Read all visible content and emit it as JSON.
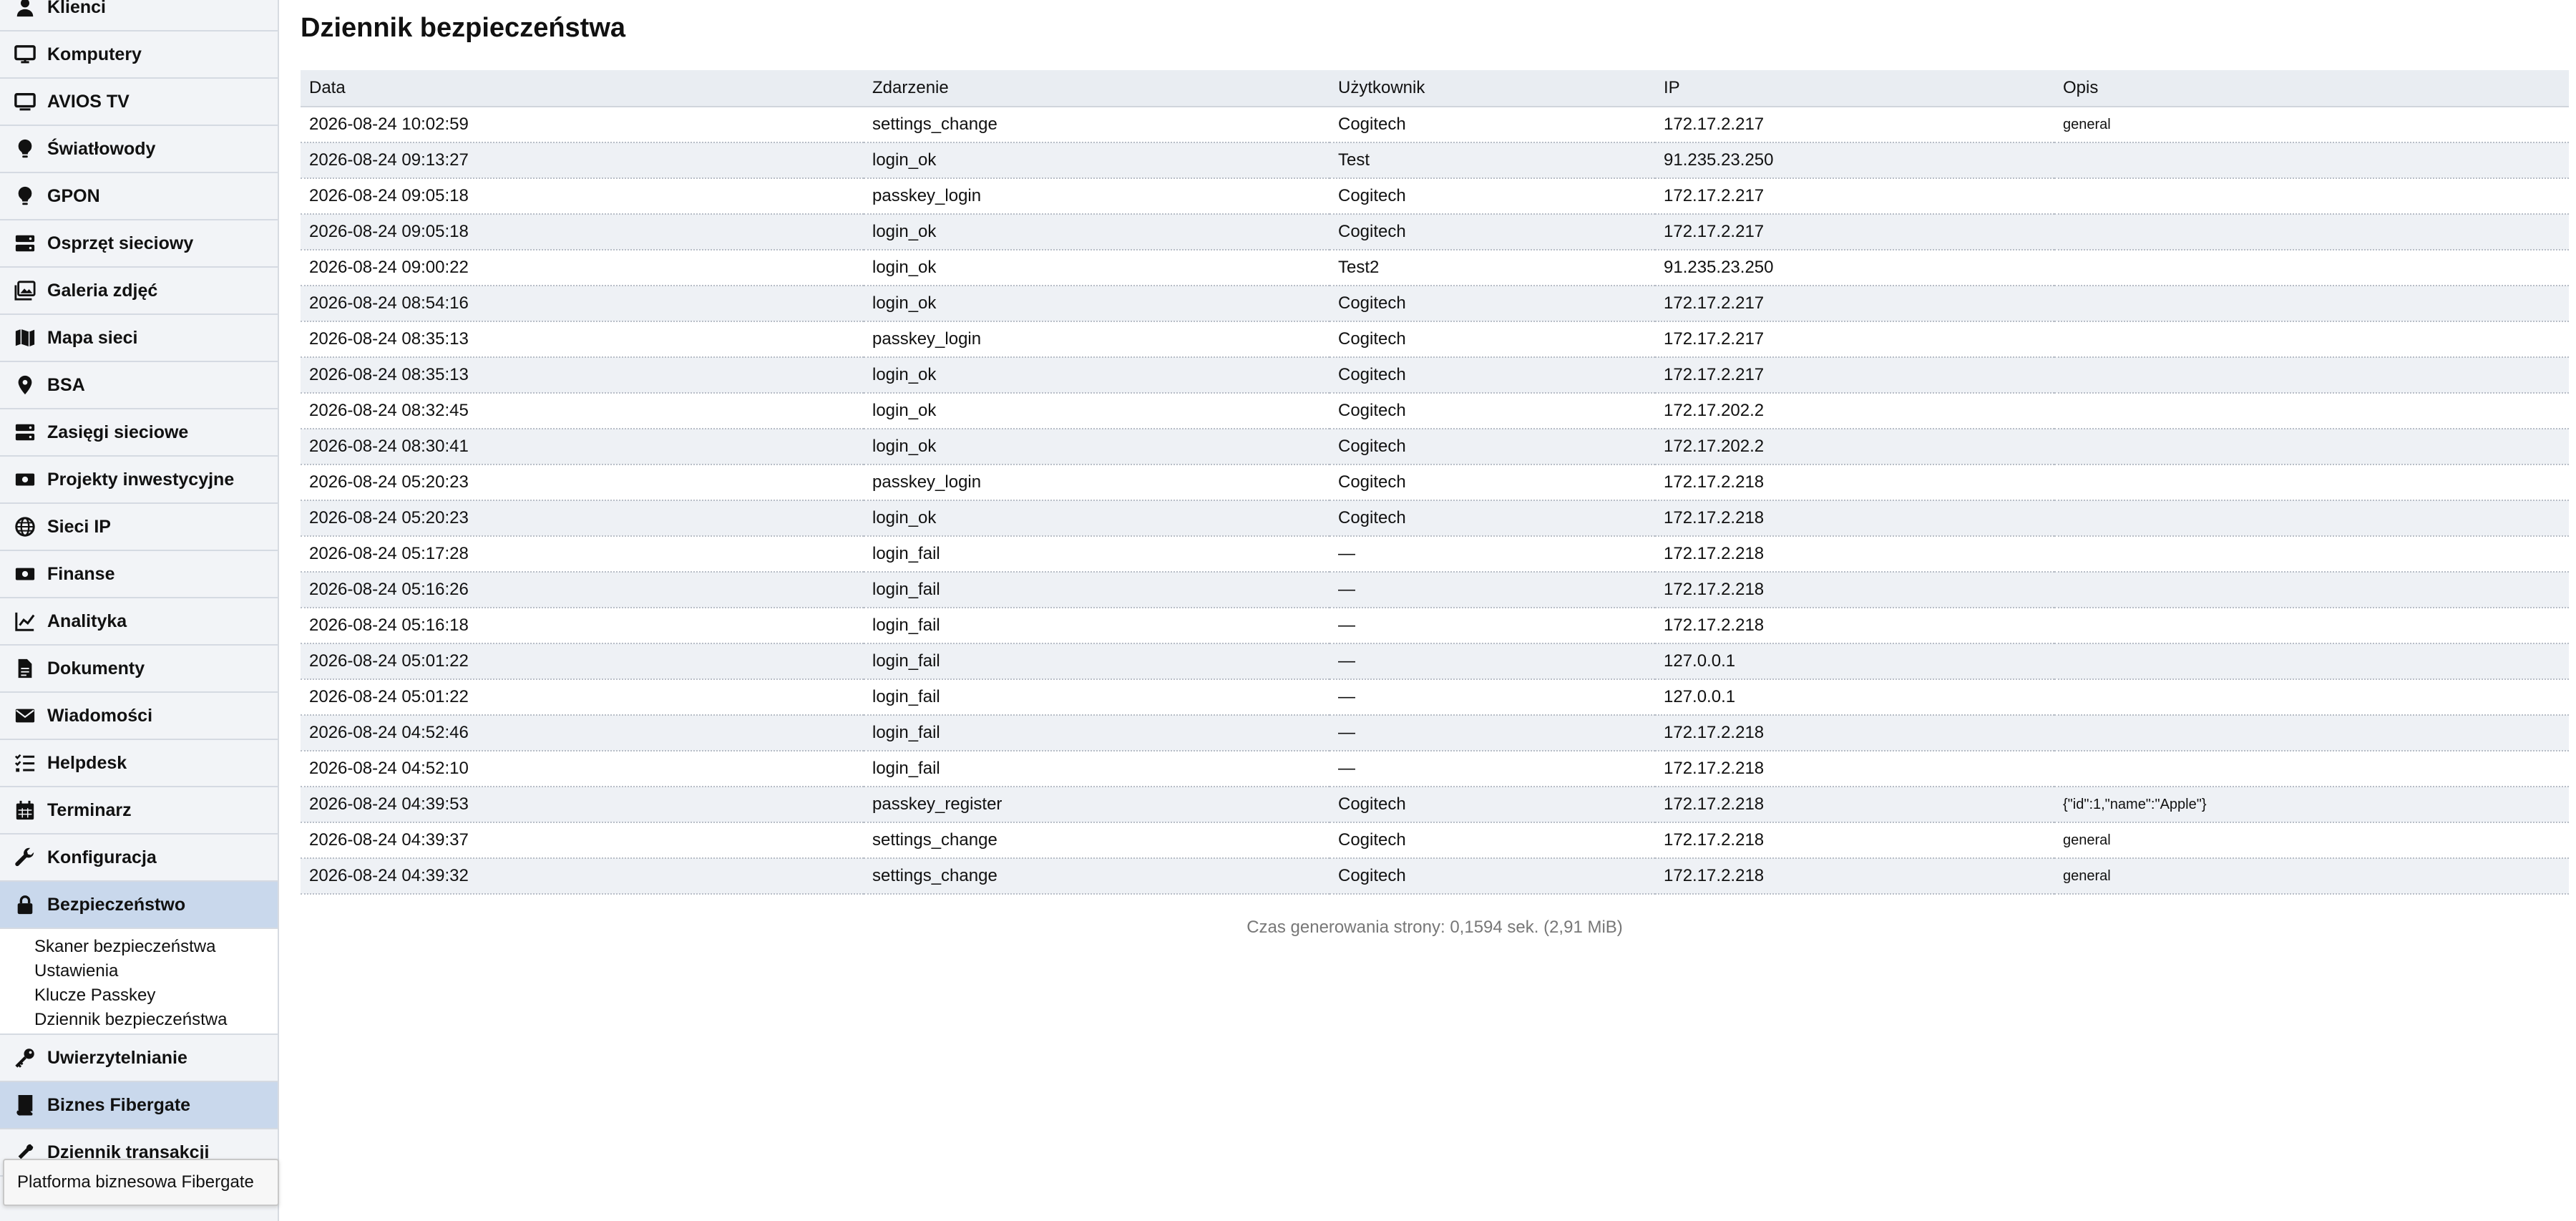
{
  "sidebar": {
    "items": [
      {
        "label": "Klienci",
        "icon": "user-icon"
      },
      {
        "label": "Komputery",
        "icon": "monitor-icon"
      },
      {
        "label": "AVIOS TV",
        "icon": "tv-icon"
      },
      {
        "label": "Światłowody",
        "icon": "lightbulb-icon"
      },
      {
        "label": "GPON",
        "icon": "lightbulb-icon"
      },
      {
        "label": "Osprzęt sieciowy",
        "icon": "server-icon"
      },
      {
        "label": "Galeria zdjęć",
        "icon": "images-icon"
      },
      {
        "label": "Mapa sieci",
        "icon": "map-icon"
      },
      {
        "label": "BSA",
        "icon": "location-pin-icon"
      },
      {
        "label": "Zasięgi sieciowe",
        "icon": "server-icon"
      },
      {
        "label": "Projekty inwestycyjne",
        "icon": "money-bill-icon"
      },
      {
        "label": "Sieci IP",
        "icon": "globe-icon"
      },
      {
        "label": "Finanse",
        "icon": "money-bill-icon"
      },
      {
        "label": "Analityka",
        "icon": "chart-line-icon"
      },
      {
        "label": "Dokumenty",
        "icon": "document-icon"
      },
      {
        "label": "Wiadomości",
        "icon": "envelope-icon"
      },
      {
        "label": "Helpdesk",
        "icon": "list-check-icon"
      },
      {
        "label": "Terminarz",
        "icon": "calendar-icon"
      },
      {
        "label": "Konfiguracja",
        "icon": "wrench-icon"
      },
      {
        "label": "Bezpieczeństwo",
        "icon": "lock-icon"
      }
    ],
    "security_submenu": [
      "Skaner bezpieczeństwa",
      "Ustawienia",
      "Klucze Passkey",
      "Dziennik bezpieczeństwa"
    ],
    "items_after": [
      {
        "label": "Uwierzytelnianie",
        "icon": "key-icon"
      },
      {
        "label": "Biznes Fibergate",
        "icon": "book-icon"
      },
      {
        "label": "Dziennik transakcji",
        "icon": "tool-icon"
      }
    ],
    "tooltip": "Platforma biznesowa Fibergate"
  },
  "main": {
    "title": "Dziennik bezpieczeństwa",
    "columns": [
      "Data",
      "Zdarzenie",
      "Użytkownik",
      "IP",
      "Opis"
    ],
    "rows": [
      [
        "2026-08-24 10:02:59",
        "settings_change",
        "Cogitech",
        "172.17.2.217",
        "general"
      ],
      [
        "2026-08-24 09:13:27",
        "login_ok",
        "Test",
        "91.235.23.250",
        ""
      ],
      [
        "2026-08-24 09:05:18",
        "passkey_login",
        "Cogitech",
        "172.17.2.217",
        ""
      ],
      [
        "2026-08-24 09:05:18",
        "login_ok",
        "Cogitech",
        "172.17.2.217",
        ""
      ],
      [
        "2026-08-24 09:00:22",
        "login_ok",
        "Test2",
        "91.235.23.250",
        ""
      ],
      [
        "2026-08-24 08:54:16",
        "login_ok",
        "Cogitech",
        "172.17.2.217",
        ""
      ],
      [
        "2026-08-24 08:35:13",
        "passkey_login",
        "Cogitech",
        "172.17.2.217",
        ""
      ],
      [
        "2026-08-24 08:35:13",
        "login_ok",
        "Cogitech",
        "172.17.2.217",
        ""
      ],
      [
        "2026-08-24 08:32:45",
        "login_ok",
        "Cogitech",
        "172.17.202.2",
        ""
      ],
      [
        "2026-08-24 08:30:41",
        "login_ok",
        "Cogitech",
        "172.17.202.2",
        ""
      ],
      [
        "2026-08-24 05:20:23",
        "passkey_login",
        "Cogitech",
        "172.17.2.218",
        ""
      ],
      [
        "2026-08-24 05:20:23",
        "login_ok",
        "Cogitech",
        "172.17.2.218",
        ""
      ],
      [
        "2026-08-24 05:17:28",
        "login_fail",
        "—",
        "172.17.2.218",
        ""
      ],
      [
        "2026-08-24 05:16:26",
        "login_fail",
        "—",
        "172.17.2.218",
        ""
      ],
      [
        "2026-08-24 05:16:18",
        "login_fail",
        "—",
        "172.17.2.218",
        ""
      ],
      [
        "2026-08-24 05:01:22",
        "login_fail",
        "—",
        "127.0.0.1",
        ""
      ],
      [
        "2026-08-24 05:01:22",
        "login_fail",
        "—",
        "127.0.0.1",
        ""
      ],
      [
        "2026-08-24 04:52:46",
        "login_fail",
        "—",
        "172.17.2.218",
        ""
      ],
      [
        "2026-08-24 04:52:10",
        "login_fail",
        "—",
        "172.17.2.218",
        ""
      ],
      [
        "2026-08-24 04:39:53",
        "passkey_register",
        "Cogitech",
        "172.17.2.218",
        "{\"id\":1,\"name\":\"Apple\"}"
      ],
      [
        "2026-08-24 04:39:37",
        "settings_change",
        "Cogitech",
        "172.17.2.218",
        "general"
      ],
      [
        "2026-08-24 04:39:32",
        "settings_change",
        "Cogitech",
        "172.17.2.218",
        "general"
      ]
    ],
    "footer": "Czas generowania strony: 0,1594 sek. (2,91 MiB)"
  },
  "colors": {
    "sidebar_bg": "#f2f4f7",
    "active_item_bg": "#c9d8ec",
    "table_header_bg": "#e9edf2",
    "row_alt_bg": "#eef1f5"
  }
}
